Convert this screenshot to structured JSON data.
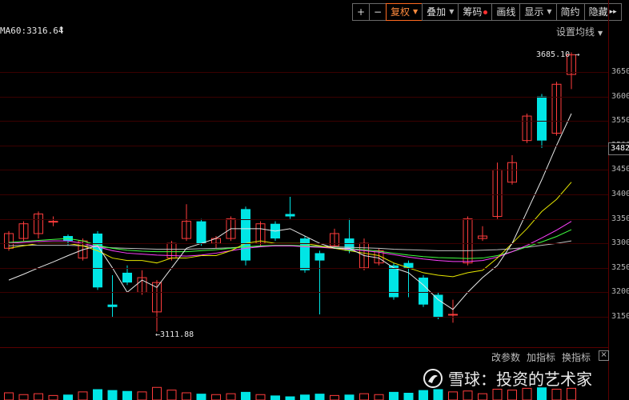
{
  "toolbar": {
    "plus": "+",
    "minus": "−",
    "fuquan": "复权",
    "overlay": "叠加",
    "chips": "筹码",
    "draw": "画线",
    "display": "显示",
    "simple": "简约",
    "hide": "隐藏",
    "hide_arrow": "▸▸"
  },
  "ma_label": "MA60:3316.64",
  "ma_arrow": "↑",
  "settings_label": "设置均线",
  "yaxis": [
    "3650",
    "3600",
    "3550",
    "3500",
    "3450",
    "3400",
    "3350",
    "3300",
    "3250",
    "3200",
    "3150"
  ],
  "current_price": "3482",
  "annotations": {
    "high": "3685.10",
    "low": "3111.88",
    "high_arrow": "→",
    "low_arrow": "←"
  },
  "indicator_bar": {
    "change": "改参数",
    "add": "加指标",
    "switch": "换指标",
    "close": "×"
  },
  "watermark": "雪球：投资的艺术家",
  "colors": {
    "up": "#ff3c3c",
    "down": "#00e5e5",
    "ma5": "#e8e8e8",
    "ma10": "#e6e600",
    "ma20": "#ff40ff",
    "ma60": "#40ff40",
    "ma_gray": "#c0c0c0"
  },
  "chart_data": {
    "type": "candlestick",
    "ylim": [
      3125,
      3700
    ],
    "candles": [
      {
        "o": 3290,
        "c": 3320,
        "h": 3325,
        "l": 3285
      },
      {
        "o": 3310,
        "c": 3340,
        "h": 3345,
        "l": 3305
      },
      {
        "o": 3320,
        "c": 3360,
        "h": 3365,
        "l": 3310
      },
      {
        "o": 3345,
        "c": 3345,
        "h": 3355,
        "l": 3335
      },
      {
        "o": 3315,
        "c": 3305,
        "h": 3318,
        "l": 3295
      },
      {
        "o": 3270,
        "c": 3305,
        "h": 3310,
        "l": 3265
      },
      {
        "o": 3320,
        "c": 3210,
        "h": 3325,
        "l": 3205
      },
      {
        "o": 3175,
        "c": 3170,
        "h": 3235,
        "l": 3150
      },
      {
        "o": 3240,
        "c": 3220,
        "h": 3255,
        "l": 3215
      },
      {
        "o": 3200,
        "c": 3230,
        "h": 3245,
        "l": 3195
      },
      {
        "o": 3160,
        "c": 3220,
        "h": 3225,
        "l": 3120
      },
      {
        "o": 3270,
        "c": 3300,
        "h": 3305,
        "l": 3265
      },
      {
        "o": 3310,
        "c": 3345,
        "h": 3380,
        "l": 3305
      },
      {
        "o": 3345,
        "c": 3300,
        "h": 3350,
        "l": 3295
      },
      {
        "o": 3300,
        "c": 3310,
        "h": 3315,
        "l": 3290
      },
      {
        "o": 3310,
        "c": 3350,
        "h": 3355,
        "l": 3305
      },
      {
        "o": 3370,
        "c": 3265,
        "h": 3375,
        "l": 3255
      },
      {
        "o": 3300,
        "c": 3340,
        "h": 3345,
        "l": 3295
      },
      {
        "o": 3340,
        "c": 3310,
        "h": 3345,
        "l": 3305
      },
      {
        "o": 3360,
        "c": 3355,
        "h": 3395,
        "l": 3350
      },
      {
        "o": 3310,
        "c": 3245,
        "h": 3315,
        "l": 3240
      },
      {
        "o": 3280,
        "c": 3265,
        "h": 3285,
        "l": 3155
      },
      {
        "o": 3295,
        "c": 3320,
        "h": 3330,
        "l": 3290
      },
      {
        "o": 3310,
        "c": 3285,
        "h": 3350,
        "l": 3280
      },
      {
        "o": 3250,
        "c": 3300,
        "h": 3310,
        "l": 3245
      },
      {
        "o": 3260,
        "c": 3285,
        "h": 3290,
        "l": 3255
      },
      {
        "o": 3255,
        "c": 3190,
        "h": 3260,
        "l": 3185
      },
      {
        "o": 3260,
        "c": 3250,
        "h": 3265,
        "l": 3190
      },
      {
        "o": 3230,
        "c": 3175,
        "h": 3235,
        "l": 3170
      },
      {
        "o": 3195,
        "c": 3150,
        "h": 3200,
        "l": 3145
      },
      {
        "o": 3155,
        "c": 3155,
        "h": 3185,
        "l": 3138
      },
      {
        "o": 3260,
        "c": 3350,
        "h": 3355,
        "l": 3255
      },
      {
        "o": 3310,
        "c": 3315,
        "h": 3335,
        "l": 3305
      },
      {
        "o": 3355,
        "c": 3450,
        "h": 3465,
        "l": 3350
      },
      {
        "o": 3425,
        "c": 3465,
        "h": 3480,
        "l": 3420
      },
      {
        "o": 3510,
        "c": 3560,
        "h": 3565,
        "l": 3505
      },
      {
        "o": 3600,
        "c": 3510,
        "h": 3605,
        "l": 3495
      },
      {
        "o": 3525,
        "c": 3625,
        "h": 3630,
        "l": 3520
      },
      {
        "o": 3645,
        "c": 3685,
        "h": 3690,
        "l": 3615
      }
    ],
    "ma_white": [
      3225,
      3237,
      3250,
      3262,
      3275,
      3287,
      3295,
      3250,
      3200,
      3225,
      3210,
      3250,
      3290,
      3300,
      3310,
      3330,
      3330,
      3330,
      3325,
      3330,
      3315,
      3300,
      3290,
      3290,
      3275,
      3270,
      3250,
      3240,
      3215,
      3185,
      3165,
      3200,
      3230,
      3255,
      3300,
      3365,
      3430,
      3500,
      3565
    ],
    "ma_yellow": [
      3290,
      3295,
      3300,
      3300,
      3300,
      3295,
      3285,
      3270,
      3265,
      3265,
      3260,
      3270,
      3270,
      3275,
      3275,
      3285,
      3300,
      3305,
      3300,
      3300,
      3300,
      3295,
      3290,
      3285,
      3280,
      3275,
      3260,
      3250,
      3240,
      3235,
      3232,
      3240,
      3245,
      3270,
      3300,
      3330,
      3365,
      3390,
      3425
    ],
    "ma_magenta": [
      3300,
      3302,
      3304,
      3305,
      3305,
      3300,
      3293,
      3285,
      3280,
      3278,
      3276,
      3275,
      3274,
      3276,
      3280,
      3285,
      3290,
      3293,
      3295,
      3295,
      3293,
      3292,
      3290,
      3288,
      3285,
      3282,
      3277,
      3272,
      3268,
      3265,
      3263,
      3263,
      3265,
      3272,
      3283,
      3296,
      3311,
      3327,
      3345
    ],
    "ma_green": [
      3302,
      3304,
      3306,
      3308,
      3310,
      3305,
      3296,
      3290,
      3286,
      3284,
      3283,
      3283,
      3283,
      3285,
      3287,
      3290,
      3293,
      3295,
      3296,
      3296,
      3295,
      3293,
      3291,
      3289,
      3287,
      3284,
      3280,
      3276,
      3273,
      3271,
      3270,
      3269,
      3270,
      3275,
      3283,
      3293,
      3303,
      3314,
      3328
    ],
    "ma_gray": [
      3295,
      3296,
      3296,
      3296,
      3296,
      3295,
      3293,
      3291,
      3290,
      3289,
      3288,
      3288,
      3288,
      3289,
      3290,
      3291,
      3293,
      3294,
      3295,
      3295,
      3295,
      3294,
      3293,
      3292,
      3291,
      3290,
      3288,
      3287,
      3286,
      3285,
      3285,
      3285,
      3286,
      3287,
      3289,
      3292,
      3296,
      3300,
      3305
    ],
    "volume": [
      40,
      30,
      35,
      25,
      30,
      45,
      60,
      55,
      50,
      45,
      70,
      55,
      40,
      35,
      30,
      35,
      45,
      30,
      25,
      20,
      30,
      35,
      25,
      30,
      35,
      30,
      45,
      40,
      55,
      60,
      45,
      50,
      35,
      60,
      55,
      65,
      70,
      60,
      65
    ]
  }
}
